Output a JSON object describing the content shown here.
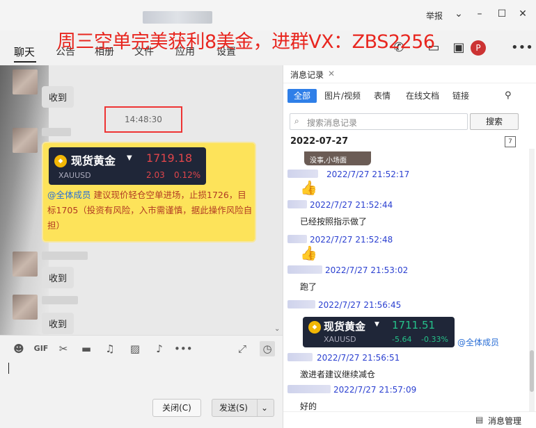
{
  "window": {
    "report_label": "举报",
    "promo_text": "周三空单完美获利8美金，进群VX：ZBS2256"
  },
  "tabs": [
    {
      "label": "聊天"
    },
    {
      "label": "公告"
    },
    {
      "label": "相册"
    },
    {
      "label": "文件"
    },
    {
      "label": "应用"
    },
    {
      "label": "设置"
    }
  ],
  "chat": {
    "received_label": "收到",
    "time_chip": "14:48:30",
    "gold_card": {
      "name": "现货黄金",
      "code": "XAUUSD",
      "price": "1719.18",
      "change": "2.03",
      "change_pct": "0.12%",
      "mention": "@全体成员",
      "message": " 建议现价轻仓空单进场，止损1726，目标1705（投资有风险，入市需谨慎，据此操作风险自担）"
    }
  },
  "input": {
    "close_label": "关闭(C)",
    "send_label": "发送(S)",
    "gif_label": "GIF"
  },
  "sidebar": {
    "title": "消息记录",
    "filters": [
      "全部",
      "图片/视频",
      "表情",
      "在线文档",
      "链接"
    ],
    "search_placeholder": "搜索消息记录",
    "search_button": "搜索",
    "date": "2022-07-27",
    "img_caption": "没事,小场面",
    "messages": [
      {
        "time": "2022/7/27 21:52:17"
      },
      {
        "time": "2022/7/27 21:52:44",
        "text": "已经按照指示做了"
      },
      {
        "time": "2022/7/27 21:52:48"
      },
      {
        "time": "2022/7/27 21:53:02",
        "text": "跑了"
      },
      {
        "time": "2022/7/27 21:56:45"
      },
      {
        "time": "2022/7/27 21:56:51",
        "text": "激进者建议继续减仓"
      },
      {
        "time": "2022/7/27 21:57:09",
        "text": "好的"
      }
    ],
    "mini_card": {
      "name": "现货黄金",
      "code": "XAUUSD",
      "price": "1711.51",
      "change": "-5.64",
      "change_pct": "-0.33%",
      "mention": "@全体成员"
    },
    "manage_label": "消息管理"
  },
  "colors": {
    "accent": "#2f7fe8",
    "promo": "#e8261f",
    "up": "#e0454a",
    "down": "#25c28a"
  }
}
